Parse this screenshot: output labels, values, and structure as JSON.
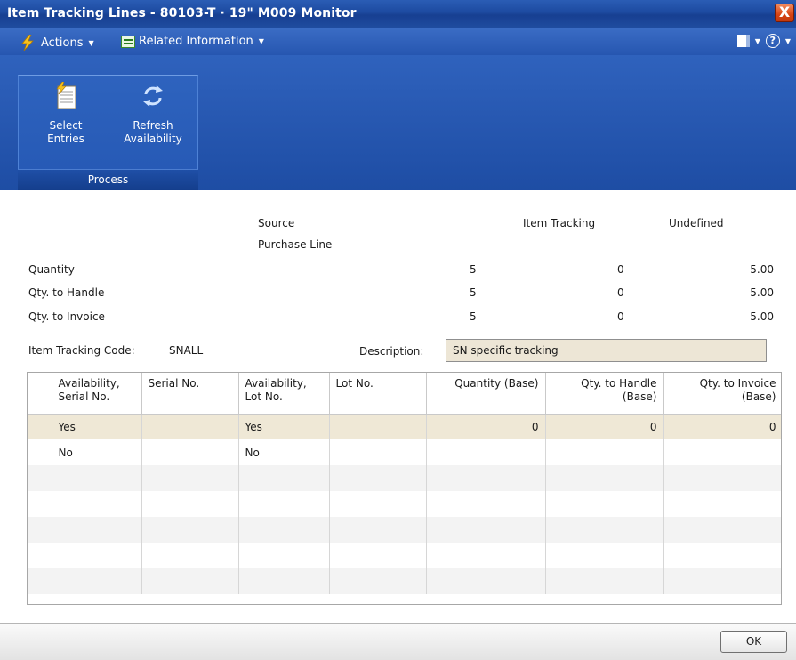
{
  "window": {
    "title": "Item Tracking Lines - 80103-T · 19\" M009 Monitor",
    "close_glyph": "X"
  },
  "menubar": {
    "actions_label": "Actions",
    "related_label": "Related Information"
  },
  "ribbon": {
    "select_entries": [
      "Select",
      "Entries"
    ],
    "refresh_availability": [
      "Refresh",
      "Availability"
    ],
    "group_label": "Process"
  },
  "summary": {
    "headers": {
      "source": "Source",
      "source_sub": "Purchase Line",
      "item_tracking": "Item Tracking",
      "undefined": "Undefined"
    },
    "rows": [
      {
        "label": "Quantity",
        "source": "5",
        "tracking": "0",
        "undefined": "5.00"
      },
      {
        "label": "Qty. to Handle",
        "source": "5",
        "tracking": "0",
        "undefined": "5.00"
      },
      {
        "label": "Qty. to Invoice",
        "source": "5",
        "tracking": "0",
        "undefined": "5.00"
      }
    ]
  },
  "tracking_code": {
    "label": "Item Tracking Code:",
    "value": "SNALL",
    "description_label": "Description:",
    "description_value": "SN specific tracking"
  },
  "grid": {
    "columns": [
      {
        "label": "Availability, Serial No.",
        "lines": [
          "Availability,",
          "Serial No."
        ]
      },
      {
        "label": "Serial No.",
        "lines": [
          "Serial No."
        ]
      },
      {
        "label": "Availability, Lot No.",
        "lines": [
          "Availability,",
          "Lot No."
        ]
      },
      {
        "label": "Lot No.",
        "lines": [
          "Lot No."
        ]
      },
      {
        "label": "Quantity (Base)",
        "lines": [
          "Quantity (Base)"
        ]
      },
      {
        "label": "Qty. to Handle (Base)",
        "lines": [
          "Qty. to Handle",
          "(Base)"
        ]
      },
      {
        "label": "Qty. to Invoice (Base)",
        "lines": [
          "Qty. to Invoice",
          "(Base)"
        ]
      }
    ],
    "rows": [
      {
        "avail_serial": "Yes",
        "serial_no": "",
        "avail_lot": "Yes",
        "lot_no": "",
        "qty_base": "0",
        "qty_handle": "0",
        "qty_invoice": "0"
      },
      {
        "avail_serial": "No",
        "serial_no": "",
        "avail_lot": "No",
        "lot_no": "",
        "qty_base": "",
        "qty_handle": "",
        "qty_invoice": ""
      }
    ]
  },
  "footer": {
    "ok_label": "OK"
  },
  "colors": {
    "titlebar": "#1d4aa0",
    "ribbon": "#2558b4",
    "selected_row": "#efe8d6",
    "description_box": "#ede6d6"
  }
}
